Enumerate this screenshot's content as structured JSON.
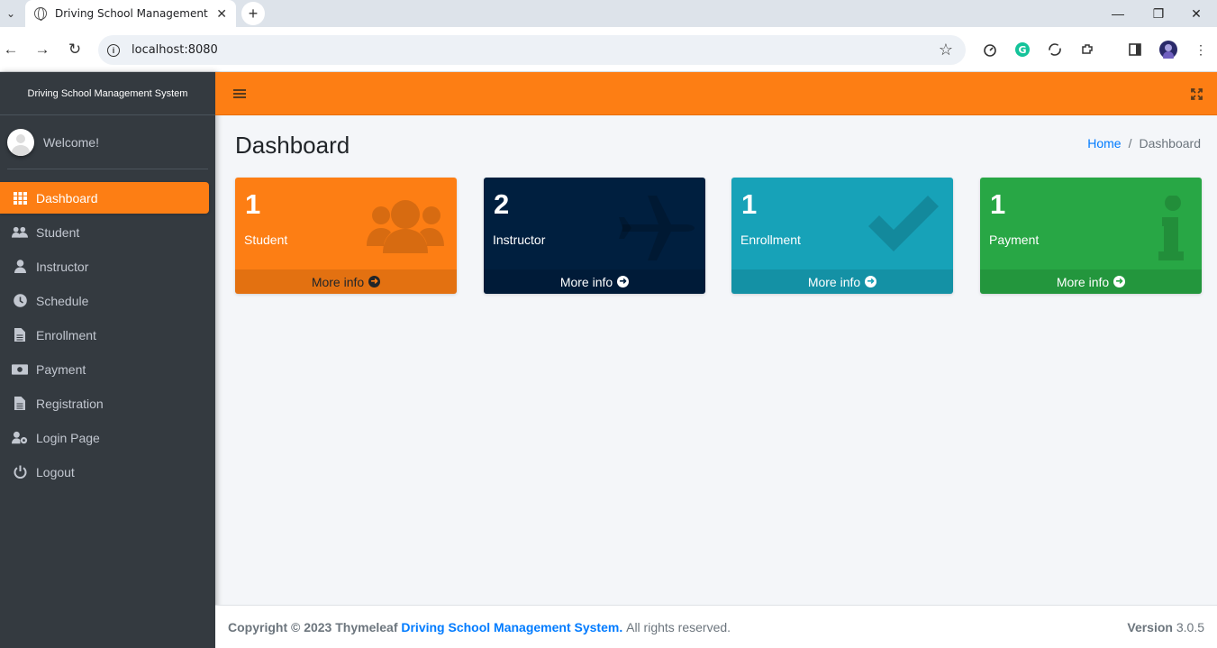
{
  "browser": {
    "tab_title": "Driving School Management System",
    "url": "localhost:8080"
  },
  "sidebar": {
    "brand": "Driving School Management System",
    "welcome": "Welcome!",
    "items": [
      {
        "label": "Dashboard",
        "icon": "grid-icon",
        "active": true
      },
      {
        "label": "Student",
        "icon": "users-icon"
      },
      {
        "label": "Instructor",
        "icon": "user-icon"
      },
      {
        "label": "Schedule",
        "icon": "clock-icon"
      },
      {
        "label": "Enrollment",
        "icon": "file-icon"
      },
      {
        "label": "Payment",
        "icon": "money-icon"
      },
      {
        "label": "Registration",
        "icon": "file-icon"
      },
      {
        "label": "Login Page",
        "icon": "user-cog-icon"
      },
      {
        "label": "Logout",
        "icon": "power-icon"
      }
    ]
  },
  "header": {
    "title": "Dashboard",
    "breadcrumb": {
      "home": "Home",
      "sep": "/",
      "current": "Dashboard"
    }
  },
  "boxes": [
    {
      "count": "1",
      "label": "Student",
      "more": "More info",
      "color": "#fd7e14",
      "icon": "users-icon"
    },
    {
      "count": "2",
      "label": "Instructor",
      "more": "More info",
      "color": "#001f3f",
      "icon": "plane-icon"
    },
    {
      "count": "1",
      "label": "Enrollment",
      "more": "More info",
      "color": "#17a2b8",
      "icon": "check-icon"
    },
    {
      "count": "1",
      "label": "Payment",
      "more": "More info",
      "color": "#28a745",
      "icon": "info-icon"
    }
  ],
  "footer": {
    "copyright": "Copyright © 2023 Thymeleaf",
    "brand": "Driving School Management System.",
    "rights": "All rights reserved.",
    "version_label": "Version",
    "version": "3.0.5"
  }
}
